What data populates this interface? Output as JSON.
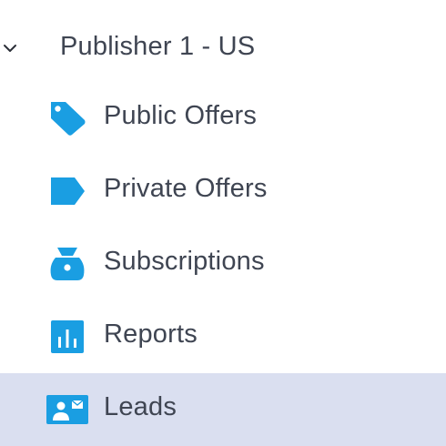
{
  "group": {
    "title": "Publisher 1 - US",
    "expanded": true
  },
  "items": [
    {
      "label": "Public Offers",
      "icon": "tag-icon",
      "active": false
    },
    {
      "label": "Private Offers",
      "icon": "label-icon",
      "active": false
    },
    {
      "label": "Subscriptions",
      "icon": "subscription-icon",
      "active": false
    },
    {
      "label": "Reports",
      "icon": "bar-chart-icon",
      "active": false
    },
    {
      "label": "Leads",
      "icon": "contact-card-icon",
      "active": true
    }
  ],
  "colors": {
    "icon": "#1a9ee2",
    "text": "#3f4552",
    "active_background": "#dadff0"
  }
}
